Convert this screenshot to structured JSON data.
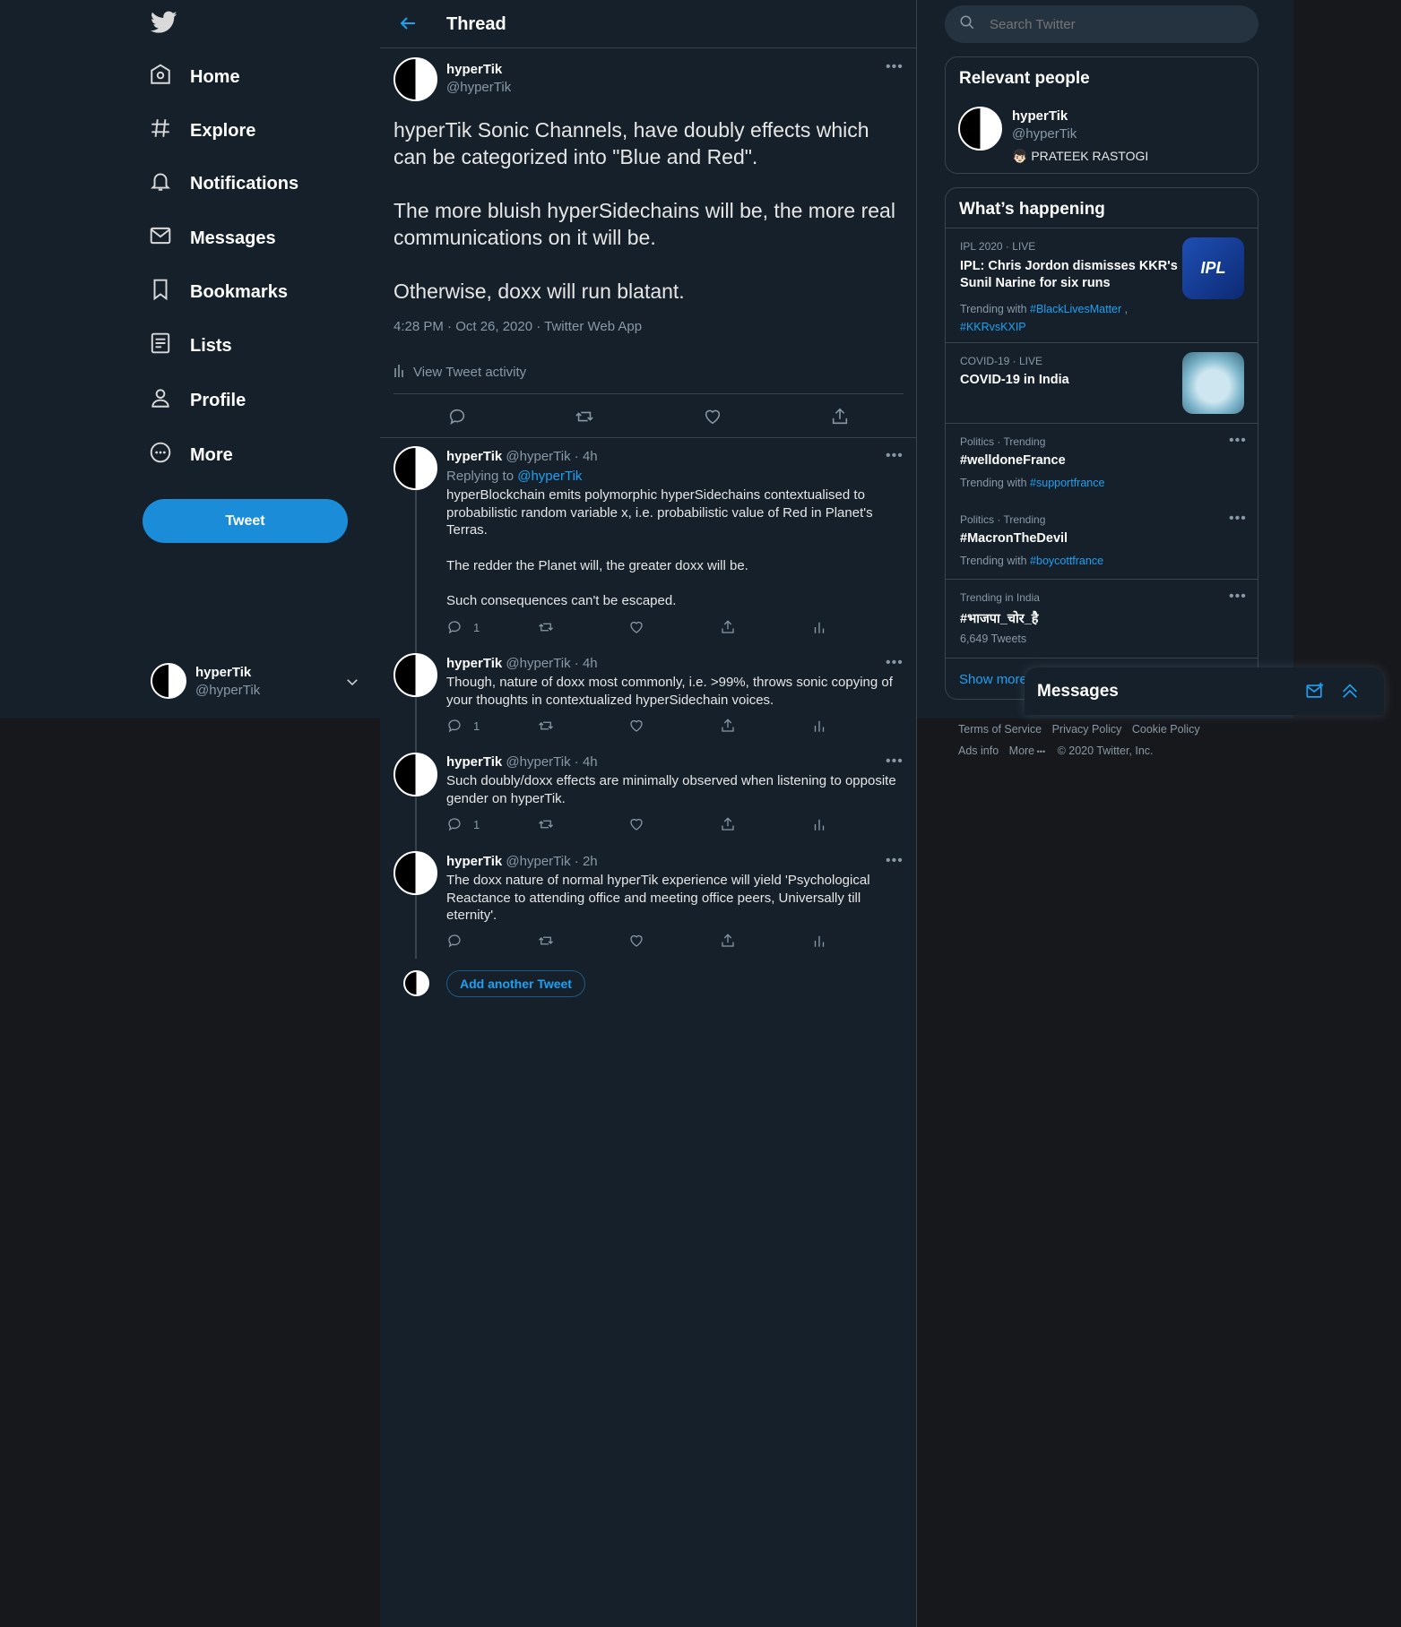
{
  "sidebar": {
    "nav": [
      {
        "label": "Home",
        "icon": "home-icon"
      },
      {
        "label": "Explore",
        "icon": "hashtag-icon"
      },
      {
        "label": "Notifications",
        "icon": "bell-icon"
      },
      {
        "label": "Messages",
        "icon": "envelope-icon"
      },
      {
        "label": "Bookmarks",
        "icon": "bookmark-icon"
      },
      {
        "label": "Lists",
        "icon": "list-icon"
      },
      {
        "label": "Profile",
        "icon": "person-icon"
      },
      {
        "label": "More",
        "icon": "more-circle-icon"
      }
    ],
    "tweet_button": "Tweet",
    "account": {
      "name": "hyperTik",
      "handle": "@hyperTik"
    }
  },
  "header": {
    "title": "Thread"
  },
  "main_tweet": {
    "name": "hyperTik",
    "handle": "@hyperTik",
    "paragraphs": [
      "hyperTik Sonic Channels, have doubly effects which can be categorized into \"Blue and Red\".",
      "The more bluish hyperSidechains will be, the more real communications on it will be.",
      "Otherwise, doxx will run blatant."
    ],
    "meta": "4:28 PM · Oct 26, 2020 · Twitter Web App",
    "activity": "View Tweet activity"
  },
  "replies": [
    {
      "name": "hyperTik",
      "handle": "@hyperTik",
      "time": "· 4h",
      "replying_prefix": "Replying to ",
      "replying_to": "@hyperTik",
      "paragraphs": [
        "hyperBlockchain emits polymorphic hyperSidechains contextualised to probabilistic random variable x, i.e. probabilistic value of Red in Planet's Terras.",
        "The redder the Planet will, the greater doxx will be.",
        "Such consequences can't be escaped."
      ],
      "reply_count": "1"
    },
    {
      "name": "hyperTik",
      "handle": "@hyperTik",
      "time": "· 4h",
      "paragraphs": [
        "Though, nature of doxx most commonly, i.e. >99%, throws sonic copying of your thoughts in contextualized hyperSidechain voices."
      ],
      "reply_count": "1"
    },
    {
      "name": "hyperTik",
      "handle": "@hyperTik",
      "time": "· 4h",
      "paragraphs": [
        "Such doubly/doxx effects are minimally observed when listening to opposite gender on hyperTik."
      ],
      "reply_count": "1"
    },
    {
      "name": "hyperTik",
      "handle": "@hyperTik",
      "time": "· 2h",
      "paragraphs": [
        "The doxx nature of normal hyperTik experience will yield 'Psychological Reactance to attending office and meeting office peers, Universally till eternity'."
      ],
      "reply_count": ""
    }
  ],
  "add_another": "Add another Tweet",
  "search": {
    "placeholder": "Search Twitter"
  },
  "relevant": {
    "title": "Relevant people",
    "name": "hyperTik",
    "handle": "@hyperTik",
    "bio": "👦🏻 PRATEEK RASTOGI"
  },
  "happening": {
    "title": "What’s happening",
    "items": [
      {
        "context": "IPL 2020 · LIVE",
        "title": "IPL: Chris Jordon dismisses KKR's Sunil Narine for six runs",
        "with_prefix": "Trending with ",
        "tags": [
          "#BlackLivesMatter",
          "#KKRvsKXIP"
        ],
        "thumb_text": "IPL"
      },
      {
        "context": "COVID-19 · LIVE",
        "title": "COVID-19 in India"
      },
      {
        "context": "Politics · Trending",
        "title": "#welldoneFrance",
        "with_prefix": "Trending with ",
        "tags": [
          "#supportfrance"
        ]
      },
      {
        "context": "Politics · Trending",
        "title": "#MacronTheDevil",
        "with_prefix": "Trending with ",
        "tags": [
          "#boycottfrance"
        ]
      },
      {
        "context": "Trending in India",
        "title": "#भाजपा_चोर_है",
        "count": "6,649 Tweets"
      }
    ],
    "show_more": "Show more"
  },
  "messages_dock": {
    "title": "Messages"
  },
  "footer": {
    "links1": [
      "Terms of Service",
      "Privacy Policy",
      "Cookie Policy"
    ],
    "links2": [
      "Ads info",
      "More",
      "© 2020 Twitter, Inc."
    ]
  },
  "colors": {
    "accent": "#1da1f2",
    "background": "#15202b",
    "border": "#38444d"
  }
}
